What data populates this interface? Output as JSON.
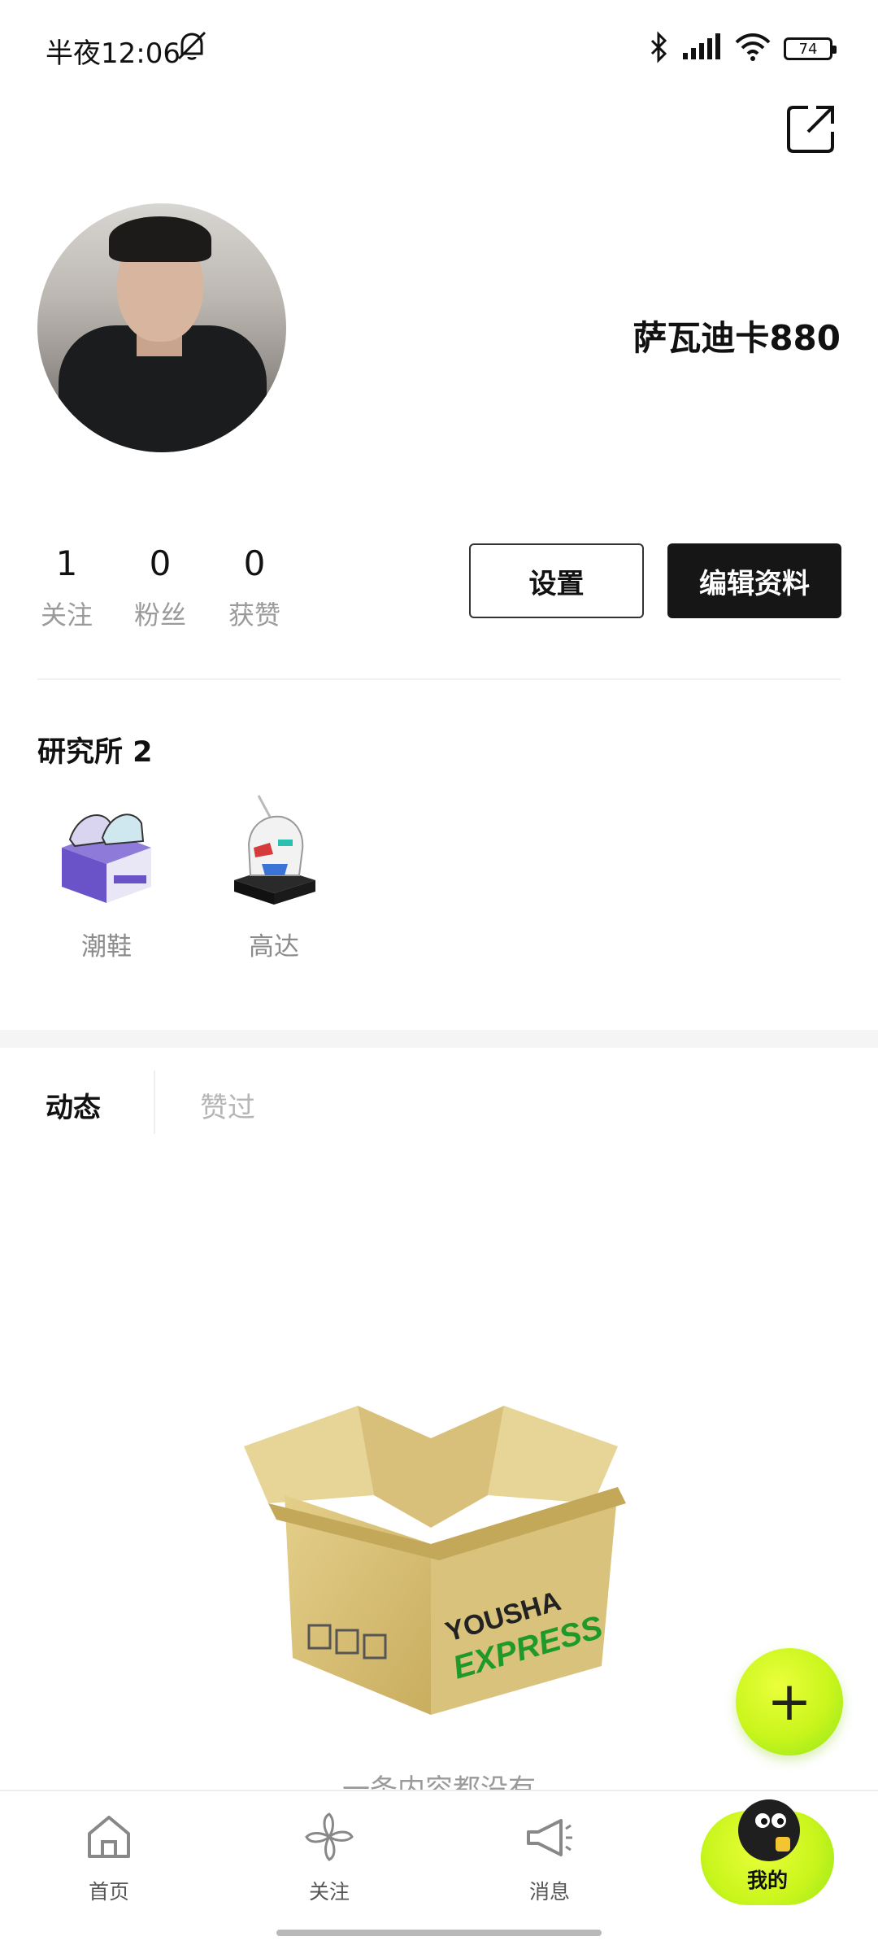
{
  "status_bar": {
    "time": "半夜12:06",
    "battery": "74"
  },
  "profile": {
    "username": "萨瓦迪卡880"
  },
  "stats": [
    {
      "value": "1",
      "label": "关注"
    },
    {
      "value": "0",
      "label": "粉丝"
    },
    {
      "value": "0",
      "label": "获赞"
    }
  ],
  "buttons": {
    "settings": "设置",
    "edit_profile": "编辑资料"
  },
  "lab": {
    "title": "研究所 2",
    "items": [
      {
        "label": "潮鞋",
        "icon": "sneaker-box-icon"
      },
      {
        "label": "高达",
        "icon": "gundam-head-icon"
      }
    ]
  },
  "tabs": {
    "active": "动态",
    "inactive": "赞过"
  },
  "empty_state": {
    "text": "一条内容都没有",
    "box_brand": "YOUSHA"
  },
  "fab": {
    "label": "+"
  },
  "nav": {
    "home": "首页",
    "follow": "关注",
    "messages": "消息",
    "mine": "我的"
  },
  "colors": {
    "accent": "#c9f51c",
    "dark_button": "#161616"
  }
}
